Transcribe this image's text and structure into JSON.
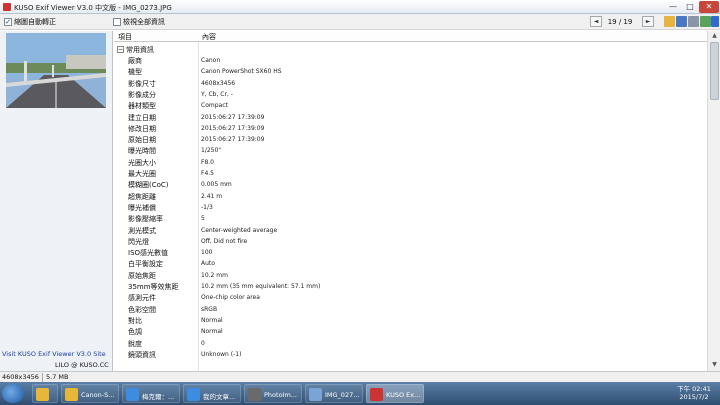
{
  "window": {
    "title": "KUSO Exif Viewer V3.0 中文版 - IMG_0273.JPG",
    "min": "—",
    "max": "□",
    "close": "✕"
  },
  "toolbar": {
    "auto_rotate_label": "縮圖自動轉正",
    "auto_rotate_checked": true,
    "show_all_label": "檢視全部資訊",
    "show_all_checked": false,
    "prev": "◄",
    "counter": "19 / 19",
    "next": "►",
    "icons": [
      "open-folder-icon",
      "save-icon",
      "list-icon",
      "image-icon",
      "info-icon",
      "help-icon"
    ]
  },
  "sidebar": {
    "site_link": "Visit KUSO Exif Viewer V3.0 Site",
    "credit": "LILO @ KUSO.CC"
  },
  "grid": {
    "col_item": "項目",
    "col_value": "內容",
    "group": "常用資訊",
    "rows": [
      {
        "k": "廠商",
        "v": "Canon"
      },
      {
        "k": "機型",
        "v": "Canon PowerShot SX60 HS"
      },
      {
        "k": "影像尺寸",
        "v": "4608x3456"
      },
      {
        "k": "影像成分",
        "v": "Y, Cb, Cr, -"
      },
      {
        "k": "器材類型",
        "v": "Compact"
      },
      {
        "k": "建立日期",
        "v": "2015:06:27 17:39:09"
      },
      {
        "k": "修改日期",
        "v": "2015:06:27 17:39:09"
      },
      {
        "k": "原始日期",
        "v": "2015:06:27 17:39:09"
      },
      {
        "k": "曝光時間",
        "v": "1/250\""
      },
      {
        "k": "光圈大小",
        "v": "F8.0"
      },
      {
        "k": "最大光圈",
        "v": "F4.5"
      },
      {
        "k": "模糊圈(CoC)",
        "v": "0.005 mm"
      },
      {
        "k": "超焦距離",
        "v": "2.41 m"
      },
      {
        "k": "曝光補償",
        "v": "-1/3"
      },
      {
        "k": "影像壓縮率",
        "v": "5"
      },
      {
        "k": "測光模式",
        "v": "Center-weighted average"
      },
      {
        "k": "閃光燈",
        "v": "Off, Did not fire"
      },
      {
        "k": "ISO感光數值",
        "v": "100"
      },
      {
        "k": "白平衡設定",
        "v": "Auto"
      },
      {
        "k": "原始焦距",
        "v": "10.2 mm"
      },
      {
        "k": "35mm等效焦距",
        "v": "10.2 mm (35 mm equivalent: 57.1 mm)"
      },
      {
        "k": "感測元件",
        "v": "One-chip color area"
      },
      {
        "k": "色彩空間",
        "v": "sRGB"
      },
      {
        "k": "對比",
        "v": "Normal"
      },
      {
        "k": "色調",
        "v": "Normal"
      },
      {
        "k": "銳度",
        "v": "0"
      },
      {
        "k": "鏡頭資訊",
        "v": "Unknown (-1)"
      }
    ]
  },
  "statusbar": {
    "dimensions": "4608x3456",
    "filesize": "5.7 MB"
  },
  "taskbar": {
    "items": [
      {
        "label": "",
        "icon": "explorer-folder-icon",
        "color": "#e7b73a"
      },
      {
        "label": "Canon-S...",
        "icon": "folder-icon",
        "color": "#e7b73a"
      },
      {
        "label": "梅克爾：...",
        "icon": "ie-icon",
        "color": "#3c8de0"
      },
      {
        "label": "我的文章...",
        "icon": "ie-icon",
        "color": "#3c8de0"
      },
      {
        "label": "PhotoIm...",
        "icon": "photoimpact-icon",
        "color": "#6a6a6a"
      },
      {
        "label": "IMG_027...",
        "icon": "image-viewer-icon",
        "color": "#7aa3d6"
      },
      {
        "label": "KUSO Ex...",
        "icon": "kuso-exif-icon",
        "color": "#c33"
      }
    ],
    "clock_time": "下午 02:41",
    "clock_date": "2015/7/2"
  }
}
